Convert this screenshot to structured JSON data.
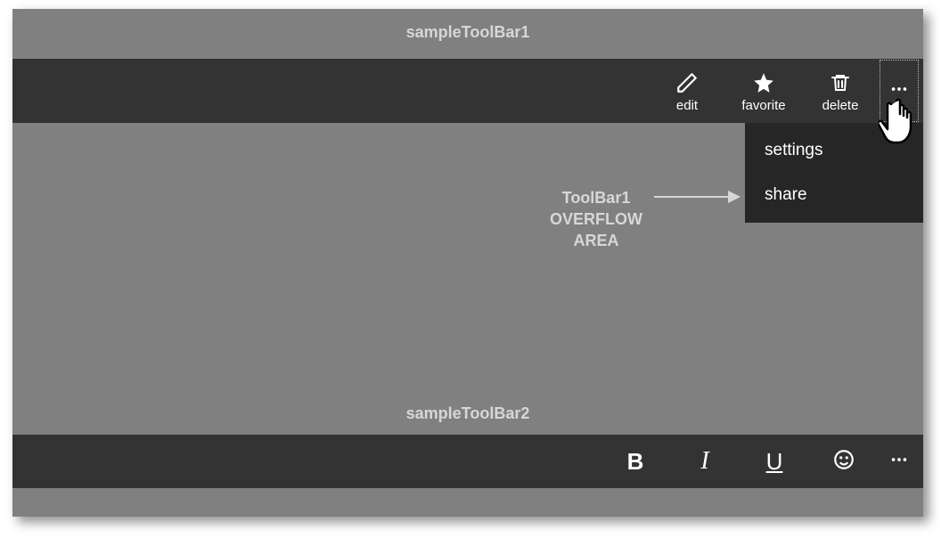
{
  "labels": {
    "toolbar1_title": "sampleToolBar1",
    "toolbar2_title": "sampleToolBar2",
    "overflow_badge_l1": "ToolBar1",
    "overflow_badge_l2": "OVERFLOW",
    "overflow_badge_l3": "AREA"
  },
  "toolbar1": {
    "buttons": [
      {
        "name": "edit",
        "label": "edit",
        "icon": "pencil-icon"
      },
      {
        "name": "favorite",
        "label": "favorite",
        "icon": "star-icon"
      },
      {
        "name": "delete",
        "label": "delete",
        "icon": "trash-icon"
      }
    ],
    "overflow": {
      "icon": "ellipsis-icon",
      "items": [
        {
          "name": "settings",
          "label": "settings"
        },
        {
          "name": "share",
          "label": "share"
        }
      ]
    }
  },
  "toolbar2": {
    "buttons": [
      {
        "name": "bold",
        "label": "B",
        "icon": "bold-icon"
      },
      {
        "name": "italic",
        "label": "I",
        "icon": "italic-icon"
      },
      {
        "name": "underline",
        "label": "U",
        "icon": "underline-icon"
      },
      {
        "name": "emoji",
        "label": "☺",
        "icon": "emoji-icon"
      }
    ],
    "overflow": {
      "icon": "ellipsis-icon"
    }
  }
}
